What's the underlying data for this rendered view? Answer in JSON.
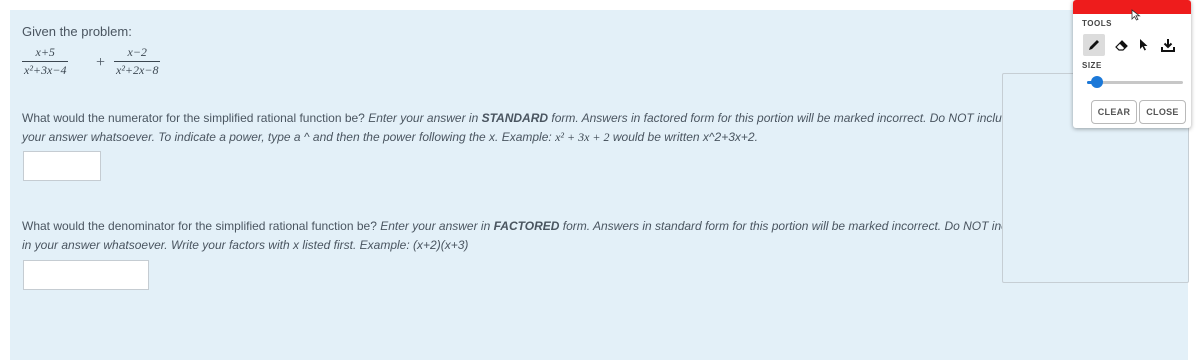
{
  "problem": {
    "prompt": "Given the problem:",
    "fraction1": {
      "numerator": "x+5",
      "denominator": "x²+3x−4"
    },
    "operator": "+",
    "fraction2": {
      "numerator": "x−2",
      "denominator": "x²+2x−8"
    }
  },
  "question1": {
    "p1": "What would the numerator for the simplified rational function be?",
    "p2": "Enter your answer in",
    "emph": "STANDARD",
    "p3": "form. Answers in factored form for this portion will be marked incorrect. Do NOT include spaces in",
    "p4": "your answer whatsoever. To indicate a power, type a ^ and then the power following the x. Example:",
    "example_math": "x² + 3x + 2",
    "p5": "would be written x^2+3x+2.",
    "answer_value": ""
  },
  "question2": {
    "p1": "What would the denominator for the simplified rational function be?",
    "p2": "Enter your answer in",
    "emph": "FACTORED",
    "p3": "form. Answers in standard form for this portion will be marked incorrect. Do NOT include any spaces",
    "p4": "in your answer whatsoever. Write your factors with x listed first. Example: (x+2)(x+3)",
    "answer_value": ""
  },
  "tools_panel": {
    "title": "TOOLS",
    "size_label": "SIZE",
    "size_value": 0.1,
    "active_color": "#ee1c1c",
    "tools": [
      "pencil-icon",
      "eraser-icon",
      "pointer-icon",
      "download-icon"
    ],
    "clear_label": "CLEAR",
    "close_label": "CLOSE"
  }
}
